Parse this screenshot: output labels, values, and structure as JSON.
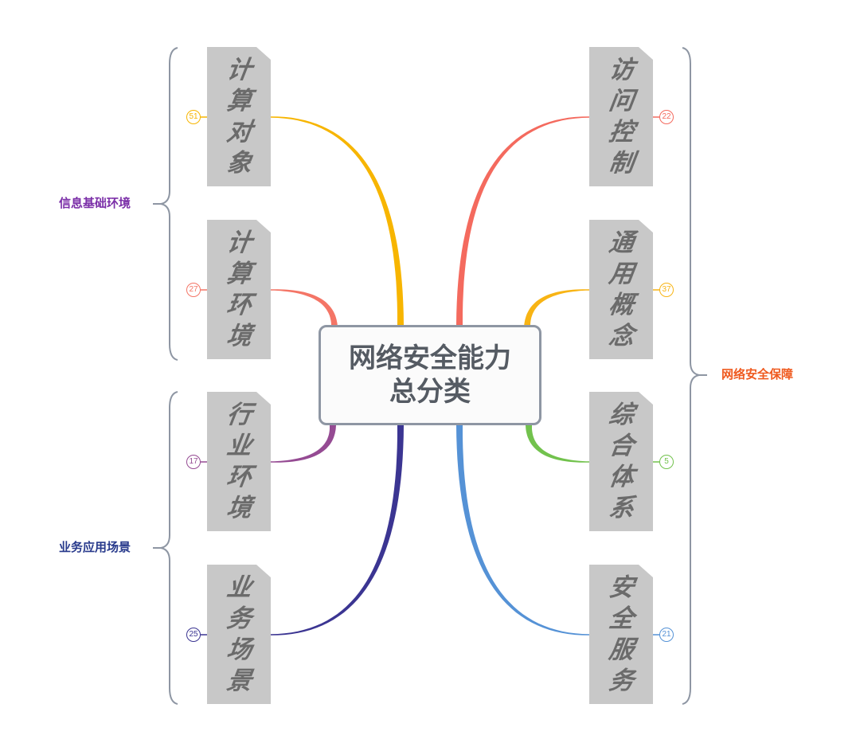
{
  "central_topic": {
    "line1": "网络安全能力",
    "line2": "总分类"
  },
  "groups": [
    {
      "label": "信息基础环境",
      "color": "#7b2fa8"
    },
    {
      "label": "业务应用场景",
      "color": "#283a8c"
    },
    {
      "label": "网络安全保障",
      "color": "#ef5a1f"
    }
  ],
  "branches": [
    {
      "chars": [
        "计",
        "算",
        "对",
        "象"
      ],
      "count": "51",
      "color": "#f7b500"
    },
    {
      "chars": [
        "计",
        "算",
        "环",
        "境"
      ],
      "count": "27",
      "color": "#f47566"
    },
    {
      "chars": [
        "行",
        "业",
        "环",
        "境"
      ],
      "count": "17",
      "color": "#954b93"
    },
    {
      "chars": [
        "业",
        "务",
        "场",
        "景"
      ],
      "count": "25",
      "color": "#3b3592"
    },
    {
      "chars": [
        "访",
        "问",
        "控",
        "制"
      ],
      "count": "22",
      "color": "#f46a5e"
    },
    {
      "chars": [
        "通",
        "用",
        "概",
        "念"
      ],
      "count": "37",
      "color": "#f8b414"
    },
    {
      "chars": [
        "综",
        "合",
        "体",
        "系"
      ],
      "count": "5",
      "color": "#72c24d"
    },
    {
      "chars": [
        "安",
        "全",
        "服",
        "务"
      ],
      "count": "21",
      "color": "#5592d6"
    }
  ],
  "colors": {
    "bracket": "#8e96a3",
    "card": "#c8c8c8",
    "card_text": "#6b6b6b",
    "central_text": "#555b63"
  }
}
